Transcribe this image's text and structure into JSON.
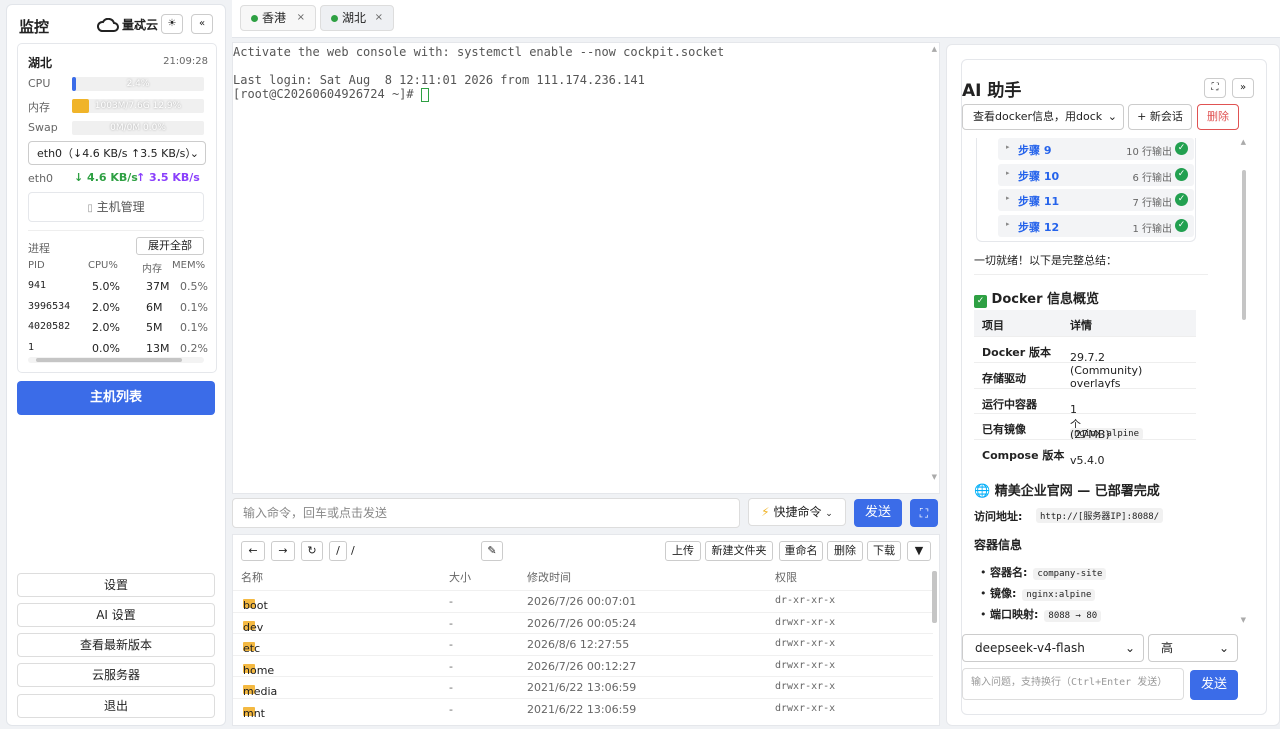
{
  "sidebar": {
    "title": "监控",
    "logo_text": "量忒云",
    "theme_icon": "☀",
    "collapse_icon": "«",
    "host": {
      "name": "湖北",
      "time": "21:09:28"
    },
    "cpu": {
      "label": "CPU",
      "text": "2.4%",
      "percent": 2.4
    },
    "mem": {
      "label": "内存",
      "text": "1003M/7.6G 12.9%",
      "percent": 12.9
    },
    "swap": {
      "label": "Swap",
      "text": "0M/0M 0.0%",
      "percent": 0
    },
    "nic_select": "eth0（↓4.6 KB/s ↑3.5 KB/s）",
    "nic": {
      "name": "eth0",
      "down": "↓ 4.6 KB/s",
      "up": "↑ 3.5 KB/s"
    },
    "host_manage": "主机管理",
    "proc": {
      "label": "进程",
      "expand": "展开全部",
      "headers": [
        "PID",
        "CPU%",
        "内存",
        "MEM%"
      ],
      "rows": [
        {
          "pid": "941",
          "cpu": "5.0%",
          "mem": "37M",
          "memp": "0.5%"
        },
        {
          "pid": "3996534",
          "cpu": "2.0%",
          "mem": "6M",
          "memp": "0.1%"
        },
        {
          "pid": "4020582",
          "cpu": "2.0%",
          "mem": "5M",
          "memp": "0.1%"
        },
        {
          "pid": "1",
          "cpu": "0.0%",
          "mem": "13M",
          "memp": "0.2%"
        }
      ]
    },
    "host_list": "主机列表",
    "links": [
      "设置",
      "AI 设置",
      "查看最新版本",
      "云服务器",
      "退出"
    ]
  },
  "tabs": [
    {
      "label": "香港",
      "close": "×"
    },
    {
      "label": "湖北",
      "close": "×"
    }
  ],
  "terminal": {
    "lines": [
      "Activate the web console with: systemctl enable --now cockpit.socket",
      "",
      "Last login: Sat Aug  8 12:11:01 2026 from 111.174.236.141",
      "[root@C20260604926724 ~]# "
    ]
  },
  "cmdbar": {
    "placeholder": "输入命令，回车或点击发送",
    "quick": "快捷命令",
    "send": "发送"
  },
  "files": {
    "path": "/ /",
    "buttons": [
      "上传",
      "新建文件夹",
      "重命名",
      "删除",
      "下载"
    ],
    "headers": [
      "名称",
      "大小",
      "修改时间",
      "权限"
    ],
    "rows": [
      {
        "name": "boot",
        "size": "-",
        "mtime": "2026/7/26 00:07:01",
        "perm": "dr-xr-xr-x"
      },
      {
        "name": "dev",
        "size": "-",
        "mtime": "2026/7/26 00:05:24",
        "perm": "drwxr-xr-x"
      },
      {
        "name": "etc",
        "size": "-",
        "mtime": "2026/8/6 12:27:55",
        "perm": "drwxr-xr-x"
      },
      {
        "name": "home",
        "size": "-",
        "mtime": "2026/7/26 00:12:27",
        "perm": "drwxr-xr-x"
      },
      {
        "name": "media",
        "size": "-",
        "mtime": "2021/6/22 13:06:59",
        "perm": "drwxr-xr-x"
      },
      {
        "name": "mnt",
        "size": "-",
        "mtime": "2021/6/22 13:06:59",
        "perm": "drwxr-xr-x"
      }
    ]
  },
  "ai": {
    "title": "AI 助手",
    "session_select": "查看docker信息，用dock",
    "new_session": "+ 新会话",
    "delete": "删除",
    "steps": [
      {
        "label": "步骤 9",
        "out": "10 行输出"
      },
      {
        "label": "步骤 10",
        "out": "6 行输出"
      },
      {
        "label": "步骤 11",
        "out": "7 行输出"
      },
      {
        "label": "步骤 12",
        "out": "1 行输出"
      }
    ],
    "summary": "一切就绪！以下是完整总结：",
    "docker_heading": "Docker 信息概览",
    "table_headers": [
      "项目",
      "详情"
    ],
    "table_rows": [
      {
        "k": "Docker 版本",
        "v": "29.7.2 (Community)"
      },
      {
        "k": "存储驱动",
        "v": "overlayfs"
      },
      {
        "k": "运行中容器",
        "v": "1 个"
      },
      {
        "k": "已有镜像",
        "v_code": "nginx:alpine",
        "v": " (27MB)"
      },
      {
        "k": "Compose 版本",
        "v": "v5.4.0"
      }
    ],
    "site_heading": "精美企业官网 — 已部署完成",
    "access_label": "访问地址:",
    "access_url": "http://[服务器IP]:8088/",
    "container_heading": "容器信息",
    "bullets": [
      {
        "k": "容器名:",
        "v": "company-site"
      },
      {
        "k": "镜像:",
        "v": "nginx:alpine"
      },
      {
        "k": "端口映射:",
        "v": "8088 → 80"
      }
    ],
    "model": "deepseek-v4-flash",
    "level": "高",
    "input_placeholder": "输入问题，支持换行（Ctrl+Enter 发送）",
    "send": "发送"
  }
}
